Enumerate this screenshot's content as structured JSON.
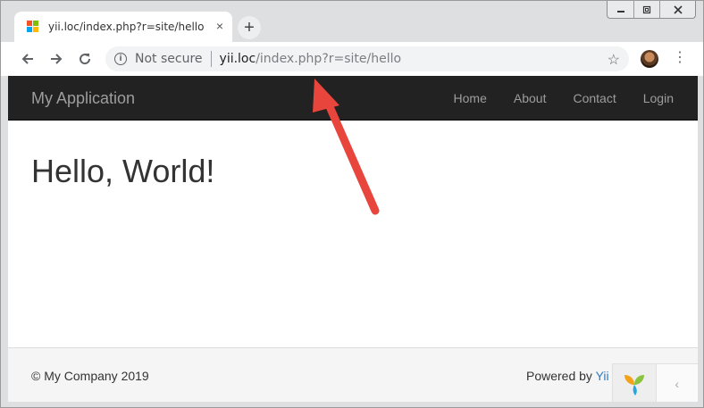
{
  "browser": {
    "tab_title": "yii.loc/index.php?r=site/hello",
    "tab_close": "×",
    "new_tab": "+",
    "security_label": "Not secure",
    "url_host": "yii.loc",
    "url_path": "/index.php?r=site/hello",
    "icons": {
      "back": "arrow-left-icon",
      "forward": "arrow-right-icon",
      "reload": "reload-icon",
      "info": "info-icon",
      "bookmark": "star-icon",
      "menu": "kebab-menu-icon",
      "minimize": "minimize-icon",
      "restore": "restore-icon",
      "close": "close-icon"
    }
  },
  "navbar": {
    "brand": "My Application",
    "links": [
      "Home",
      "About",
      "Contact",
      "Login"
    ]
  },
  "main": {
    "heading": "Hello, World!"
  },
  "footer": {
    "copyright": "© My Company 2019",
    "powered_prefix": "Powered by ",
    "powered_link": "Yii",
    "debug_toggle": "‹"
  },
  "colors": {
    "navbar_bg": "#222222",
    "navbar_text": "#9d9d9d",
    "link": "#337ab7",
    "annotation_arrow": "#e8453c"
  }
}
